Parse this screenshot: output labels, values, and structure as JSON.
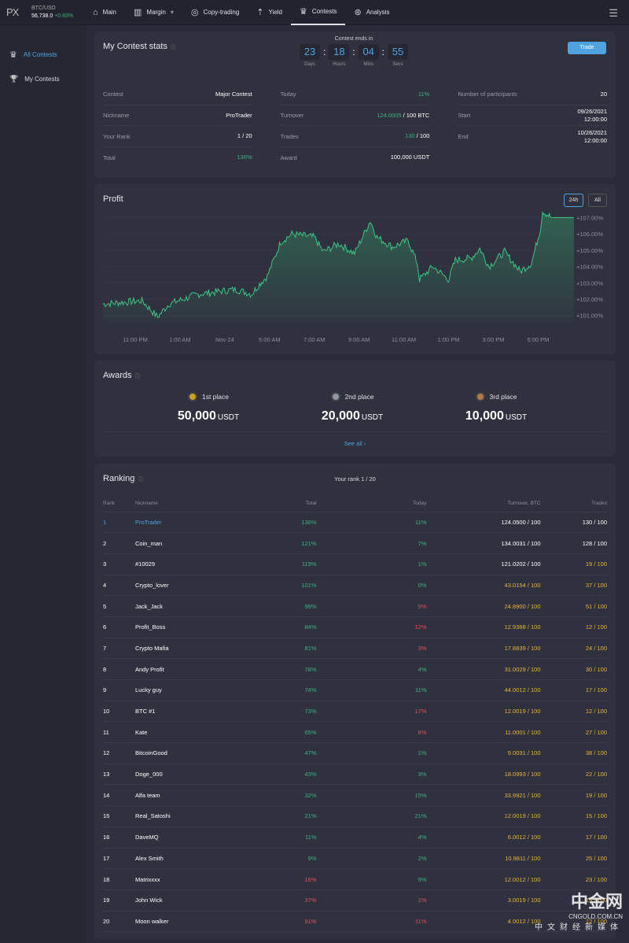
{
  "header": {
    "logo": "PX",
    "ticker_pair": "BTC/USD",
    "ticker_price": "56,738.0",
    "ticker_change": "+0.83%",
    "nav": [
      {
        "label": "Main",
        "icon": "home-icon",
        "glyph": "⌂"
      },
      {
        "label": "Margin",
        "icon": "bar-chart-icon",
        "glyph": "▥",
        "dropdown": "▾"
      },
      {
        "label": "Copy-trading",
        "icon": "copy-trading-icon",
        "glyph": "◎"
      },
      {
        "label": "Yield",
        "icon": "yield-icon",
        "glyph": "⇡"
      },
      {
        "label": "Contests",
        "icon": "contests-icon",
        "glyph": "♛"
      },
      {
        "label": "Analysis",
        "icon": "analysis-icon",
        "glyph": "⊛"
      }
    ],
    "menu_icon": "☰"
  },
  "sidebar": {
    "items": [
      {
        "label": "All Contests",
        "icon": "contests-icon",
        "glyph": "♛"
      },
      {
        "label": "My Contests",
        "icon": "trophy-icon",
        "glyph": "🏆"
      }
    ]
  },
  "stats": {
    "title": "My Contest stats",
    "info": "ⓘ",
    "timer_label": "Contest ends in",
    "timer": [
      {
        "n": "23",
        "u": "Days"
      },
      {
        "n": "18",
        "u": "Hours"
      },
      {
        "n": "04",
        "u": "Mins"
      },
      {
        "n": "55",
        "u": "Secs"
      }
    ],
    "trade_button": "Trade",
    "col1": [
      {
        "l": "Contest",
        "v": "Major Contest"
      },
      {
        "l": "Nickname",
        "v": "ProTrader"
      },
      {
        "l": "Your Rank",
        "v": "1 / 20"
      },
      {
        "l": "Total",
        "v": "136%",
        "c": "g"
      }
    ],
    "col2": [
      {
        "l": "Today",
        "v": "11%",
        "c": "g"
      },
      {
        "l": "Turnover",
        "v": "124.0005",
        "v2": " / 100 BTC",
        "c": "g"
      },
      {
        "l": "Trades",
        "v": "130",
        "v2": " / 100",
        "c": "g"
      },
      {
        "l": "Award",
        "v": "100,000 USDT"
      }
    ],
    "col3": [
      {
        "l": "Number of participants",
        "v": "20"
      },
      {
        "l": "Start",
        "v": "09/26/2021",
        "v2": "12:00:00"
      },
      {
        "l": "End",
        "v": "10/26/2021",
        "v2": "12:00:00"
      }
    ]
  },
  "chart_data": {
    "type": "area",
    "title": "Profit",
    "toggles": [
      "24h",
      "All"
    ],
    "active": "24h",
    "xlabel_ticks": [
      {
        "h": 0,
        "t": "11:00 PM"
      },
      {
        "h": 2,
        "t": "1:00 AM"
      },
      {
        "h": 4,
        "t": "Nov 24"
      },
      {
        "h": 6,
        "t": "5:00 AM"
      },
      {
        "h": 8,
        "t": "7:00 AM"
      },
      {
        "h": 10,
        "t": "9:00 AM"
      },
      {
        "h": 12,
        "t": "11:00 AM"
      },
      {
        "h": 14,
        "t": "1:00 PM"
      },
      {
        "h": 16,
        "t": "3:00 PM"
      },
      {
        "h": 18,
        "t": "5:00 PM"
      }
    ],
    "ytick_values": [
      101,
      102,
      103,
      104,
      105,
      106,
      107
    ],
    "ytick_labels": [
      "+101.00%",
      "+102.00%",
      "+103.00%",
      "+104.00%",
      "+105.00%",
      "+106.00%",
      "+107.00%"
    ],
    "ylim": [
      100.6,
      107.6
    ],
    "xlim": [
      -1.44,
      19.6
    ],
    "x_unit": "hours since 11:00 PM",
    "points": [
      [
        -1.44,
        101.7
      ],
      [
        0.3,
        101.9
      ],
      [
        1,
        100.9
      ],
      [
        1.5,
        101.7
      ],
      [
        2.8,
        102.3
      ],
      [
        4.5,
        102.6
      ],
      [
        5.2,
        102.3
      ],
      [
        5.6,
        103.0
      ],
      [
        5.9,
        103.4
      ],
      [
        6.5,
        105.5
      ],
      [
        7,
        106.0
      ],
      [
        8.0,
        105.8
      ],
      [
        8.4,
        104.9
      ],
      [
        9.1,
        105.4
      ],
      [
        9.8,
        104.8
      ],
      [
        10.5,
        106.8
      ],
      [
        10.8,
        105.8
      ],
      [
        11.5,
        105.2
      ],
      [
        12.2,
        105.6
      ],
      [
        12.6,
        104.2
      ],
      [
        12.7,
        103.2
      ],
      [
        13.3,
        104.0
      ],
      [
        14,
        103.2
      ],
      [
        14.3,
        104.4
      ],
      [
        15,
        104.5
      ],
      [
        15.4,
        105.1
      ],
      [
        15.8,
        104.0
      ],
      [
        16.5,
        104.9
      ],
      [
        17.2,
        103.7
      ],
      [
        17.7,
        104.2
      ],
      [
        18.1,
        106.3
      ],
      [
        18.2,
        107.4
      ],
      [
        18.6,
        107.0
      ],
      [
        19.6,
        107.0
      ]
    ]
  },
  "awards": {
    "title": "Awards",
    "info": "ⓘ",
    "places": [
      {
        "place": "1st place",
        "amount": "50,000",
        "unit": "USDT",
        "color": "#c9a227"
      },
      {
        "place": "2nd place",
        "amount": "20,000",
        "unit": "USDT",
        "color": "#8e98a6"
      },
      {
        "place": "3rd place",
        "amount": "10,000",
        "unit": "USDT",
        "color": "#b07a4a"
      }
    ],
    "see_all": "See all ›"
  },
  "ranking": {
    "title": "Ranking",
    "info": "ⓘ",
    "your_rank": "Your rank 1 / 20",
    "columns": [
      "Rank",
      "Nickname",
      "Total",
      "Today",
      "Turnover, BTC",
      "Trades"
    ],
    "rows": [
      [
        "1",
        "ProTrader",
        "136%",
        "11%",
        "124.0500 / 100",
        "130 / 100",
        "b",
        "g",
        "g",
        "w",
        "w"
      ],
      [
        "2",
        "Coin_man",
        "121%",
        "7%",
        "134.0031 / 100",
        "128 / 100",
        "w",
        "g",
        "g",
        "w",
        "w"
      ],
      [
        "3",
        "#10029",
        "119%",
        "1%",
        "121.0202 / 100",
        "19 / 100",
        "w",
        "g",
        "g",
        "w",
        "y"
      ],
      [
        "4",
        "Crypto_lover",
        "101%",
        "0%",
        "43.0154 / 100",
        "37 / 100",
        "w",
        "g",
        "g",
        "y",
        "y"
      ],
      [
        "5",
        "Jack_Jack",
        "99%",
        "5%",
        "24.8900 / 100",
        "51 / 100",
        "w",
        "g",
        "r",
        "y",
        "y"
      ],
      [
        "6",
        "Profit_Boss",
        "84%",
        "12%",
        "12.9388 / 100",
        "12 / 100",
        "w",
        "g",
        "r",
        "y",
        "y"
      ],
      [
        "7",
        "Crypto Mafia",
        "81%",
        "3%",
        "17.8839 / 100",
        "24 / 100",
        "w",
        "g",
        "r",
        "y",
        "y"
      ],
      [
        "8",
        "Andy Profit",
        "78%",
        "4%",
        "31.0029 / 100",
        "30 / 100",
        "w",
        "g",
        "g",
        "y",
        "y"
      ],
      [
        "9",
        "Lucky guy",
        "74%",
        "11%",
        "44.0012 / 100",
        "17 / 100",
        "w",
        "g",
        "g",
        "y",
        "y"
      ],
      [
        "10",
        "BTC #1",
        "73%",
        "17%",
        "12.0019 / 100",
        "12 / 100",
        "w",
        "g",
        "r",
        "y",
        "y"
      ],
      [
        "11",
        "Kate",
        "65%",
        "6%",
        "11.0001 / 100",
        "27 / 100",
        "w",
        "g",
        "r",
        "y",
        "y"
      ],
      [
        "12",
        "BitcoinGood",
        "47%",
        "1%",
        "9.0031 / 100",
        "38 / 100",
        "w",
        "g",
        "g",
        "y",
        "y"
      ],
      [
        "13",
        "Doge_000",
        "43%",
        "3%",
        "18.0993 / 100",
        "22 / 100",
        "w",
        "g",
        "g",
        "y",
        "y"
      ],
      [
        "14",
        "Alfa team",
        "32%",
        "15%",
        "33.9921 / 100",
        "19 / 100",
        "w",
        "g",
        "g",
        "y",
        "y"
      ],
      [
        "15",
        "Real_Satoshi",
        "21%",
        "21%",
        "12.0019 / 100",
        "15 / 100",
        "w",
        "g",
        "g",
        "y",
        "y"
      ],
      [
        "16",
        "DaveMQ",
        "11%",
        "4%",
        "6.0012 / 100",
        "17 / 100",
        "w",
        "g",
        "g",
        "y",
        "y"
      ],
      [
        "17",
        "Alex Smith",
        "9%",
        "2%",
        "10.9811 / 100",
        "25 / 100",
        "w",
        "g",
        "g",
        "y",
        "y"
      ],
      [
        "18",
        "Matrixxxx",
        "16%",
        "9%",
        "12.0012 / 100",
        "23 / 100",
        "w",
        "r",
        "g",
        "y",
        "y"
      ],
      [
        "19",
        "John Wick",
        "37%",
        "1%",
        "3.0019 / 100",
        "19 / 100",
        "w",
        "r",
        "r",
        "y",
        "y"
      ],
      [
        "20",
        "Moon walker",
        "91%",
        "11%",
        "4.0012 / 100",
        "12 / 100",
        "w",
        "r",
        "r",
        "y",
        "y"
      ]
    ]
  },
  "watermark": {
    "brand": "中金网",
    "domain": "CNGOLD.COM.CN",
    "tagline": "中文财经新媒体"
  },
  "colors": {
    "green": "#3fb27f",
    "red": "#e0525a",
    "yellow": "#e8b33b",
    "blue": "#4ea3e0"
  }
}
